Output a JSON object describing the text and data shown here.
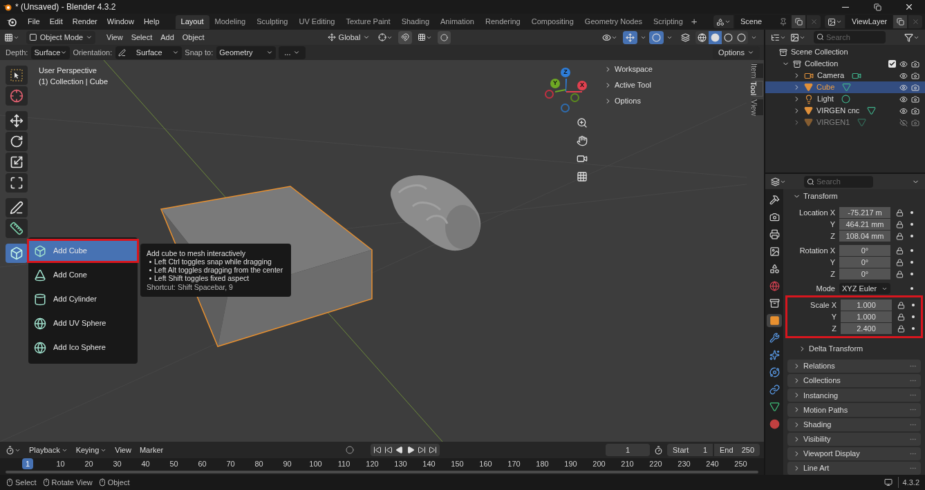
{
  "title_bar": {
    "title": "* (Unsaved) - Blender 4.3.2"
  },
  "menu_bar": {
    "menus": [
      "File",
      "Edit",
      "Render",
      "Window",
      "Help"
    ],
    "workspaces": [
      {
        "label": "Layout",
        "selected": true
      },
      {
        "label": "Modeling",
        "selected": false
      },
      {
        "label": "Sculpting",
        "selected": false
      },
      {
        "label": "UV Editing",
        "selected": false
      },
      {
        "label": "Texture Paint",
        "selected": false
      },
      {
        "label": "Shading",
        "selected": false
      },
      {
        "label": "Animation",
        "selected": false
      },
      {
        "label": "Rendering",
        "selected": false
      },
      {
        "label": "Compositing",
        "selected": false
      },
      {
        "label": "Geometry Nodes",
        "selected": false
      },
      {
        "label": "Scripting",
        "selected": false
      }
    ],
    "add_workspace": "+",
    "scene": "Scene",
    "view_layer": "ViewLayer"
  },
  "viewport_header": {
    "mode": "Object Mode",
    "menus": [
      "View",
      "Select",
      "Add",
      "Object"
    ],
    "orientation": "Global"
  },
  "tool_settings": {
    "fields": [
      {
        "label": "Depth:",
        "value": "Surface"
      },
      {
        "label": "Orientation:",
        "value": "Surface"
      },
      {
        "label": "Snap to:",
        "value": "Geometry"
      }
    ],
    "more": "...",
    "options": "Options"
  },
  "viewport": {
    "info": [
      "User Perspective",
      "(1) Collection | Cube"
    ],
    "tools": [
      {
        "kind": "select",
        "selected": false
      },
      {
        "kind": "cursor",
        "selected": false
      },
      {
        "kind": "move",
        "selected": false
      },
      {
        "kind": "rotate",
        "selected": false
      },
      {
        "kind": "scale",
        "selected": false
      },
      {
        "kind": "transform",
        "selected": false
      },
      {
        "kind": "annotate",
        "selected": false
      },
      {
        "kind": "measure",
        "selected": false
      },
      {
        "kind": "add_cube",
        "selected": true
      }
    ],
    "gizmo_axes": [
      {
        "label": "Z",
        "color": "#2e7dd8"
      },
      {
        "label": "X",
        "color": "#e0404f"
      },
      {
        "label": "Y",
        "color": "#6ea824"
      }
    ],
    "panels": [
      "Workspace",
      "Active Tool",
      "Options"
    ],
    "side_tabs": [
      {
        "label": "Item",
        "selected": false
      },
      {
        "label": "Tool",
        "selected": true
      },
      {
        "label": "View",
        "selected": false
      }
    ]
  },
  "add_menu": {
    "items": [
      {
        "label": "Add Cube",
        "kind": "cube",
        "selected": true,
        "highlighted": true
      },
      {
        "label": "Add Cone",
        "kind": "cone",
        "selected": false,
        "highlighted": false
      },
      {
        "label": "Add Cylinder",
        "kind": "cylinder",
        "selected": false,
        "highlighted": false
      },
      {
        "label": "Add UV Sphere",
        "kind": "sphere",
        "selected": false,
        "highlighted": false
      },
      {
        "label": "Add Ico Sphere",
        "kind": "sphere",
        "selected": false,
        "highlighted": false
      }
    ]
  },
  "tooltip": {
    "title": "Add cube to mesh interactively",
    "bullets": [
      "Left Ctrl toggles snap while dragging",
      "Left Alt toggles dragging from the center",
      "Left Shift toggles fixed aspect"
    ],
    "shortcut": "Shortcut: Shift Spacebar, 9"
  },
  "outliner": {
    "search": {
      "placeholder": "Search"
    },
    "scene_collection": "Scene Collection",
    "collection": {
      "label": "Collection",
      "expanded": true,
      "checked": true
    },
    "items": [
      {
        "label": "Camera",
        "kind": "camera",
        "selected": false,
        "hidden": false
      },
      {
        "label": "Cube",
        "kind": "mesh",
        "selected": true,
        "hidden": false
      },
      {
        "label": "Light",
        "kind": "light",
        "selected": false,
        "hidden": false
      },
      {
        "label": "VIRGEN cnc",
        "kind": "mesh",
        "selected": false,
        "hidden": false
      },
      {
        "label": "VIRGEN1",
        "kind": "mesh",
        "selected": false,
        "hidden": true
      }
    ]
  },
  "properties": {
    "search": {
      "placeholder": "Search"
    },
    "tabs": [
      {
        "kind": "tool",
        "selected": false
      },
      {
        "kind": "render",
        "selected": false
      },
      {
        "kind": "output",
        "selected": false
      },
      {
        "kind": "view_layer",
        "selected": false
      },
      {
        "kind": "scene",
        "selected": false
      },
      {
        "kind": "world",
        "selected": false
      },
      {
        "kind": "collection",
        "selected": false
      },
      {
        "kind": "object",
        "selected": true
      },
      {
        "kind": "modifiers",
        "selected": false
      },
      {
        "kind": "particles",
        "selected": false
      },
      {
        "kind": "physics",
        "selected": false
      },
      {
        "kind": "constraints",
        "selected": false
      },
      {
        "kind": "data",
        "selected": false
      },
      {
        "kind": "material",
        "selected": false
      }
    ],
    "transform": {
      "title": "Transform",
      "expanded": true,
      "groups": [
        {
          "highlighted": false,
          "rows": [
            {
              "kind": "field",
              "label": "Location X",
              "value": "-75.217 m"
            },
            {
              "kind": "field",
              "label": "Y",
              "value": "464.21 mm"
            },
            {
              "kind": "field",
              "label": "Z",
              "value": "108.04 mm"
            }
          ]
        },
        {
          "highlighted": false,
          "rows": [
            {
              "kind": "field",
              "label": "Rotation X",
              "value": "0°"
            },
            {
              "kind": "field",
              "label": "Y",
              "value": "0°"
            },
            {
              "kind": "field",
              "label": "Z",
              "value": "0°"
            }
          ]
        },
        {
          "highlighted": false,
          "rows": [
            {
              "kind": "dropdown",
              "label": "Mode",
              "value": "XYZ Euler"
            }
          ]
        },
        {
          "highlighted": true,
          "rows": [
            {
              "kind": "field",
              "label": "Scale X",
              "value": "1.000"
            },
            {
              "kind": "field",
              "label": "Y",
              "value": "1.000"
            },
            {
              "kind": "field",
              "label": "Z",
              "value": "2.400"
            }
          ]
        }
      ],
      "subpanel": "Delta Transform"
    },
    "panels": [
      "Relations",
      "Collections",
      "Instancing",
      "Motion Paths",
      "Shading",
      "Visibility",
      "Viewport Display",
      "Line Art"
    ]
  },
  "timeline": {
    "menus": [
      "Playback",
      "Keying",
      "View",
      "Marker"
    ],
    "current_frame": "1",
    "start": {
      "label": "Start",
      "value": "1"
    },
    "end": {
      "label": "End",
      "value": "250"
    },
    "ticks": [
      {
        "label": "1",
        "selected": true
      },
      {
        "label": "10",
        "selected": false
      },
      {
        "label": "20",
        "selected": false
      },
      {
        "label": "30",
        "selected": false
      },
      {
        "label": "40",
        "selected": false
      },
      {
        "label": "50",
        "selected": false
      },
      {
        "label": "60",
        "selected": false
      },
      {
        "label": "70",
        "selected": false
      },
      {
        "label": "80",
        "selected": false
      },
      {
        "label": "90",
        "selected": false
      },
      {
        "label": "100",
        "selected": false
      },
      {
        "label": "110",
        "selected": false
      },
      {
        "label": "120",
        "selected": false
      },
      {
        "label": "130",
        "selected": false
      },
      {
        "label": "140",
        "selected": false
      },
      {
        "label": "150",
        "selected": false
      },
      {
        "label": "160",
        "selected": false
      },
      {
        "label": "170",
        "selected": false
      },
      {
        "label": "180",
        "selected": false
      },
      {
        "label": "190",
        "selected": false
      },
      {
        "label": "200",
        "selected": false
      },
      {
        "label": "210",
        "selected": false
      },
      {
        "label": "220",
        "selected": false
      },
      {
        "label": "230",
        "selected": false
      },
      {
        "label": "240",
        "selected": false
      },
      {
        "label": "250",
        "selected": false
      }
    ]
  },
  "status_bar": {
    "hints": [
      "Select",
      "Rotate View",
      "Object"
    ],
    "version": "4.3.2"
  }
}
